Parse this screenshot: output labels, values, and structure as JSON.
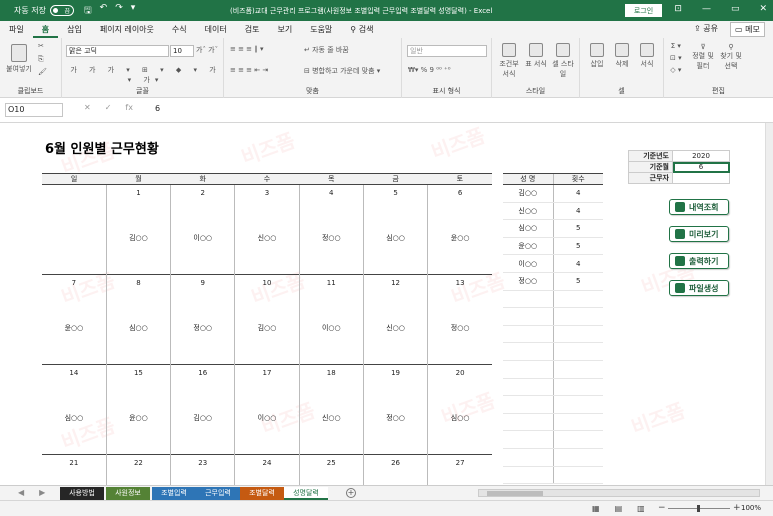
{
  "titlebar": {
    "autosave": "자동 저장",
    "toggle": "끔",
    "title": "(비즈폼)교대 근무관리 프로그램(사원정보 조별입력 근무입력 조별달력 성명달력) - Excel",
    "login": "로그인",
    "minimize": "—",
    "restore": "▭",
    "close": "✕"
  },
  "ribbon_tabs": [
    "파일",
    "홈",
    "삽입",
    "페이지 레이아웃",
    "수식",
    "데이터",
    "검토",
    "보기",
    "도움말",
    "검색"
  ],
  "share": "공유",
  "memo": "메모",
  "ribbon": {
    "paste": "붙여넣기",
    "clipboard": "클립보드",
    "font_name": "맑은 고딕",
    "font_size": "10",
    "font_group": "글꼴",
    "wrap": "자동 줄 바꿈",
    "merge": "병합하고 가운데 맞춤",
    "align_group": "맞춤",
    "number_format": "일반",
    "number_group": "표시 형식",
    "cond": "조건부 서식",
    "table": "표 서식",
    "cellstyle": "셀 스타일",
    "style_group": "스타일",
    "insert": "삽입",
    "delete": "삭제",
    "format": "서식",
    "cells_group": "셀",
    "sort": "정렬 및 필터",
    "find": "찾기 및 선택",
    "edit_group": "편집"
  },
  "formula": {
    "namebox": "O10",
    "fx": "fx",
    "value": "6"
  },
  "watermark": "비즈폼",
  "calendar": {
    "title": "6월 인원별 근무현황",
    "days": [
      "일",
      "월",
      "화",
      "수",
      "목",
      "금",
      "토"
    ],
    "weeks": [
      {
        "dates": [
          "",
          "1",
          "2",
          "3",
          "4",
          "5",
          "6"
        ],
        "names": [
          "",
          "김○○",
          "이○○",
          "신○○",
          "정○○",
          "심○○",
          "윤○○"
        ]
      },
      {
        "dates": [
          "7",
          "8",
          "9",
          "10",
          "11",
          "12",
          "13"
        ],
        "names": [
          "윤○○",
          "심○○",
          "정○○",
          "김○○",
          "이○○",
          "신○○",
          "정○○"
        ]
      },
      {
        "dates": [
          "14",
          "15",
          "16",
          "17",
          "18",
          "19",
          "20"
        ],
        "names": [
          "심○○",
          "윤○○",
          "김○○",
          "이○○",
          "신○○",
          "정○○",
          "심○○"
        ]
      },
      {
        "dates": [
          "21",
          "22",
          "23",
          "24",
          "25",
          "26",
          "27"
        ],
        "names": [
          "",
          "",
          "",
          "",
          "",
          "",
          ""
        ]
      }
    ]
  },
  "employees": {
    "headers": [
      "성 명",
      "횟수"
    ],
    "rows": [
      [
        "김○○",
        "4"
      ],
      [
        "신○○",
        "4"
      ],
      [
        "심○○",
        "5"
      ],
      [
        "윤○○",
        "5"
      ],
      [
        "이○○",
        "4"
      ],
      [
        "정○○",
        "5"
      ],
      [
        "",
        ""
      ],
      [
        "",
        ""
      ],
      [
        "",
        ""
      ],
      [
        "",
        ""
      ],
      [
        "",
        ""
      ],
      [
        "",
        ""
      ],
      [
        "",
        ""
      ],
      [
        "",
        ""
      ],
      [
        "",
        ""
      ],
      [
        "",
        ""
      ],
      [
        "",
        ""
      ]
    ]
  },
  "info": {
    "year_label": "기준년도",
    "year": "2020",
    "month_label": "기준월",
    "month": "6",
    "worker_label": "근무자",
    "worker": ""
  },
  "buttons": {
    "history": "내역조회",
    "preview": "미리보기",
    "print": "출력하기",
    "file": "파일생성"
  },
  "sheets": [
    {
      "name": "사용방법",
      "color": "#262626"
    },
    {
      "name": "사원정보",
      "color": "#548235"
    },
    {
      "name": "조별입력",
      "color": "#2e75b6"
    },
    {
      "name": "근무입력",
      "color": "#2e75b6"
    },
    {
      "name": "조별달력",
      "color": "#c55a11"
    },
    {
      "name": "성명달력",
      "color": "#ffffff"
    }
  ],
  "status": {
    "zoom": "100%"
  }
}
